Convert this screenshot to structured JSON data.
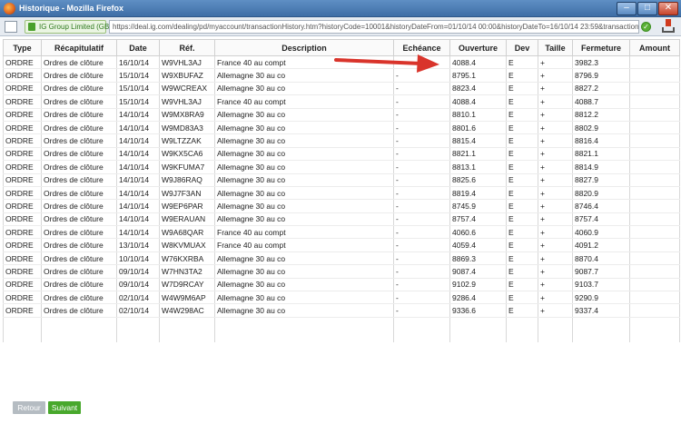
{
  "window": {
    "title": "Historique - Mozilla Firefox"
  },
  "addressbar": {
    "identity": "IG Group Limited (GB)",
    "url": "https://deal.ig.com/dealing/pd/myaccount/transactionHistory.htm?historyCode=10001&historyDateFrom=01/10/14 00:00&historyDateTo=16/10/14 23:59&transactionHistor"
  },
  "table": {
    "headers": [
      "Type",
      "Récapitulatif",
      "Date",
      "Réf.",
      "Description",
      "Echéance",
      "Ouverture",
      "Dev",
      "Taille",
      "Fermeture",
      "Amount"
    ],
    "rows": [
      [
        "ORDRE",
        "Ordres de clôture",
        "16/10/14",
        "W9VHL3AJ",
        "France 40 au compt",
        "-",
        "4088.4",
        "E",
        "+",
        "3982.3",
        ""
      ],
      [
        "ORDRE",
        "Ordres de clôture",
        "15/10/14",
        "W9XBUFAZ",
        "Allemagne 30 au co",
        "-",
        "8795.1",
        "E",
        "+",
        "8796.9",
        ""
      ],
      [
        "ORDRE",
        "Ordres de clôture",
        "15/10/14",
        "W9WCREAX",
        "Allemagne 30 au co",
        "-",
        "8823.4",
        "E",
        "+",
        "8827.2",
        ""
      ],
      [
        "ORDRE",
        "Ordres de clôture",
        "15/10/14",
        "W9VHL3AJ",
        "France 40 au compt",
        "-",
        "4088.4",
        "E",
        "+",
        "4088.7",
        ""
      ],
      [
        "ORDRE",
        "Ordres de clôture",
        "14/10/14",
        "W9MX8RA9",
        "Allemagne 30 au co",
        "-",
        "8810.1",
        "E",
        "+",
        "8812.2",
        ""
      ],
      [
        "ORDRE",
        "Ordres de clôture",
        "14/10/14",
        "W9MD83A3",
        "Allemagne 30 au co",
        "-",
        "8801.6",
        "E",
        "+",
        "8802.9",
        ""
      ],
      [
        "ORDRE",
        "Ordres de clôture",
        "14/10/14",
        "W9LTZZAK",
        "Allemagne 30 au co",
        "-",
        "8815.4",
        "E",
        "+",
        "8816.4",
        ""
      ],
      [
        "ORDRE",
        "Ordres de clôture",
        "14/10/14",
        "W9KX5CA6",
        "Allemagne 30 au co",
        "-",
        "8821.1",
        "E",
        "+",
        "8821.1",
        ""
      ],
      [
        "ORDRE",
        "Ordres de clôture",
        "14/10/14",
        "W9KFUMA7",
        "Allemagne 30 au co",
        "-",
        "8813.1",
        "E",
        "+",
        "8814.9",
        ""
      ],
      [
        "ORDRE",
        "Ordres de clôture",
        "14/10/14",
        "W9J86RAQ",
        "Allemagne 30 au co",
        "-",
        "8825.6",
        "E",
        "+",
        "8827.9",
        ""
      ],
      [
        "ORDRE",
        "Ordres de clôture",
        "14/10/14",
        "W9J7F3AN",
        "Allemagne 30 au co",
        "-",
        "8819.4",
        "E",
        "+",
        "8820.9",
        ""
      ],
      [
        "ORDRE",
        "Ordres de clôture",
        "14/10/14",
        "W9EP6PAR",
        "Allemagne 30 au co",
        "-",
        "8745.9",
        "E",
        "+",
        "8746.4",
        ""
      ],
      [
        "ORDRE",
        "Ordres de clôture",
        "14/10/14",
        "W9ERAUAN",
        "Allemagne 30 au co",
        "-",
        "8757.4",
        "E",
        "+",
        "8757.4",
        ""
      ],
      [
        "ORDRE",
        "Ordres de clôture",
        "14/10/14",
        "W9A68QAR",
        "France 40 au compt",
        "-",
        "4060.6",
        "E",
        "+",
        "4060.9",
        ""
      ],
      [
        "ORDRE",
        "Ordres de clôture",
        "13/10/14",
        "W8KVMUAX",
        "France 40 au compt",
        "-",
        "4059.4",
        "E",
        "+",
        "4091.2",
        ""
      ],
      [
        "ORDRE",
        "Ordres de clôture",
        "10/10/14",
        "W76KXRBA",
        "Allemagne 30 au co",
        "-",
        "8869.3",
        "E",
        "+",
        "8870.4",
        ""
      ],
      [
        "ORDRE",
        "Ordres de clôture",
        "09/10/14",
        "W7HN3TA2",
        "Allemagne 30 au co",
        "-",
        "9087.4",
        "E",
        "+",
        "9087.7",
        ""
      ],
      [
        "ORDRE",
        "Ordres de clôture",
        "09/10/14",
        "W7D9RCAY",
        "Allemagne 30 au co",
        "-",
        "9102.9",
        "E",
        "+",
        "9103.7",
        ""
      ],
      [
        "ORDRE",
        "Ordres de clôture",
        "02/10/14",
        "W4W9M6AP",
        "Allemagne 30 au co",
        "-",
        "9286.4",
        "E",
        "+",
        "9290.9",
        ""
      ],
      [
        "ORDRE",
        "Ordres de clôture",
        "02/10/14",
        "W4W298AC",
        "Allemagne 30 au co",
        "-",
        "9336.6",
        "E",
        "+",
        "9337.4",
        ""
      ]
    ]
  },
  "pagination": {
    "prev_label": "Retour",
    "next_label": "Suivant"
  },
  "colors": {
    "arrow": "#d9342b",
    "next_button": "#48a82c",
    "prev_button": "#b5bcc2"
  }
}
